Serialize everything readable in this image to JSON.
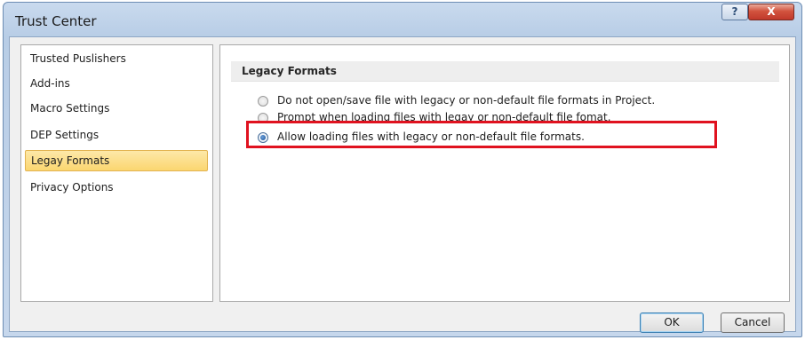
{
  "window": {
    "title": "Trust Center",
    "help_label": "?",
    "close_label": "X"
  },
  "sidebar": {
    "items": [
      {
        "label": "Trusted Puslishers"
      },
      {
        "label": "Add-ins"
      },
      {
        "label": "Macro Settings"
      },
      {
        "label": "DEP Settings"
      },
      {
        "label": "Legay Formats",
        "selected": true
      },
      {
        "label": "Privacy Options"
      }
    ]
  },
  "main": {
    "section_title": "Legacy Formats",
    "options": [
      {
        "label": "Do not open/save file with legacy or non-default file formats in Project.",
        "checked": false
      },
      {
        "label": "Prompt when loading files with legay or non-default file fomat.",
        "checked": false
      },
      {
        "label": "Allow loading files with legacy or non-default file formats.",
        "checked": true
      }
    ]
  },
  "buttons": {
    "ok_label": "OK",
    "cancel_label": "Cancel"
  },
  "colors": {
    "highlight_border": "#e0121f",
    "selected_item_bg": "#fbd670",
    "title_bar": "#b8cde6"
  }
}
